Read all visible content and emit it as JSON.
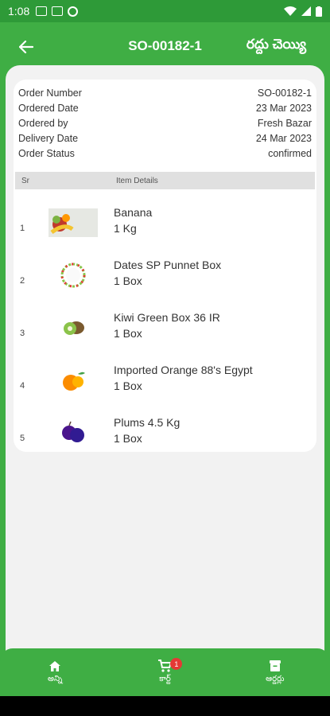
{
  "status_bar": {
    "time": "1:08"
  },
  "app_bar": {
    "title": "SO-00182-1",
    "cancel_label": "రద్దు చెయ్యి"
  },
  "order_info": [
    {
      "label": "Order Number",
      "value": "SO-00182-1"
    },
    {
      "label": "Ordered Date",
      "value": "23 Mar 2023"
    },
    {
      "label": "Ordered by",
      "value": "Fresh Bazar"
    },
    {
      "label": "Delivery Date",
      "value": "24 Mar 2023"
    },
    {
      "label": "Order Status",
      "value": "confirmed"
    }
  ],
  "table": {
    "header_sr": "Sr",
    "header_details": "Item Details",
    "items": [
      {
        "sr": "1",
        "name": "Banana",
        "qty": "1 Kg",
        "icon": "banana-image"
      },
      {
        "sr": "2",
        "name": "Dates SP Punnet Box",
        "qty": "1 Box",
        "icon": "dates-image"
      },
      {
        "sr": "3",
        "name": "Kiwi Green Box 36 IR",
        "qty": "1 Box",
        "icon": "kiwi-image"
      },
      {
        "sr": "4",
        "name": "Imported Orange 88's Egypt",
        "qty": "1 Box",
        "icon": "orange-image"
      },
      {
        "sr": "5",
        "name": "Plums 4.5 Kg",
        "qty": "1 Box",
        "icon": "plum-image"
      }
    ]
  },
  "bottom_nav": {
    "home_label": "అన్ని",
    "cart_label": "కార్ట్",
    "cart_badge": "1",
    "orders_label": "ఆర్డర్లు"
  },
  "colors": {
    "primary": "#3fae44",
    "status_bar": "#2e9a38",
    "badge": "#e53935"
  }
}
